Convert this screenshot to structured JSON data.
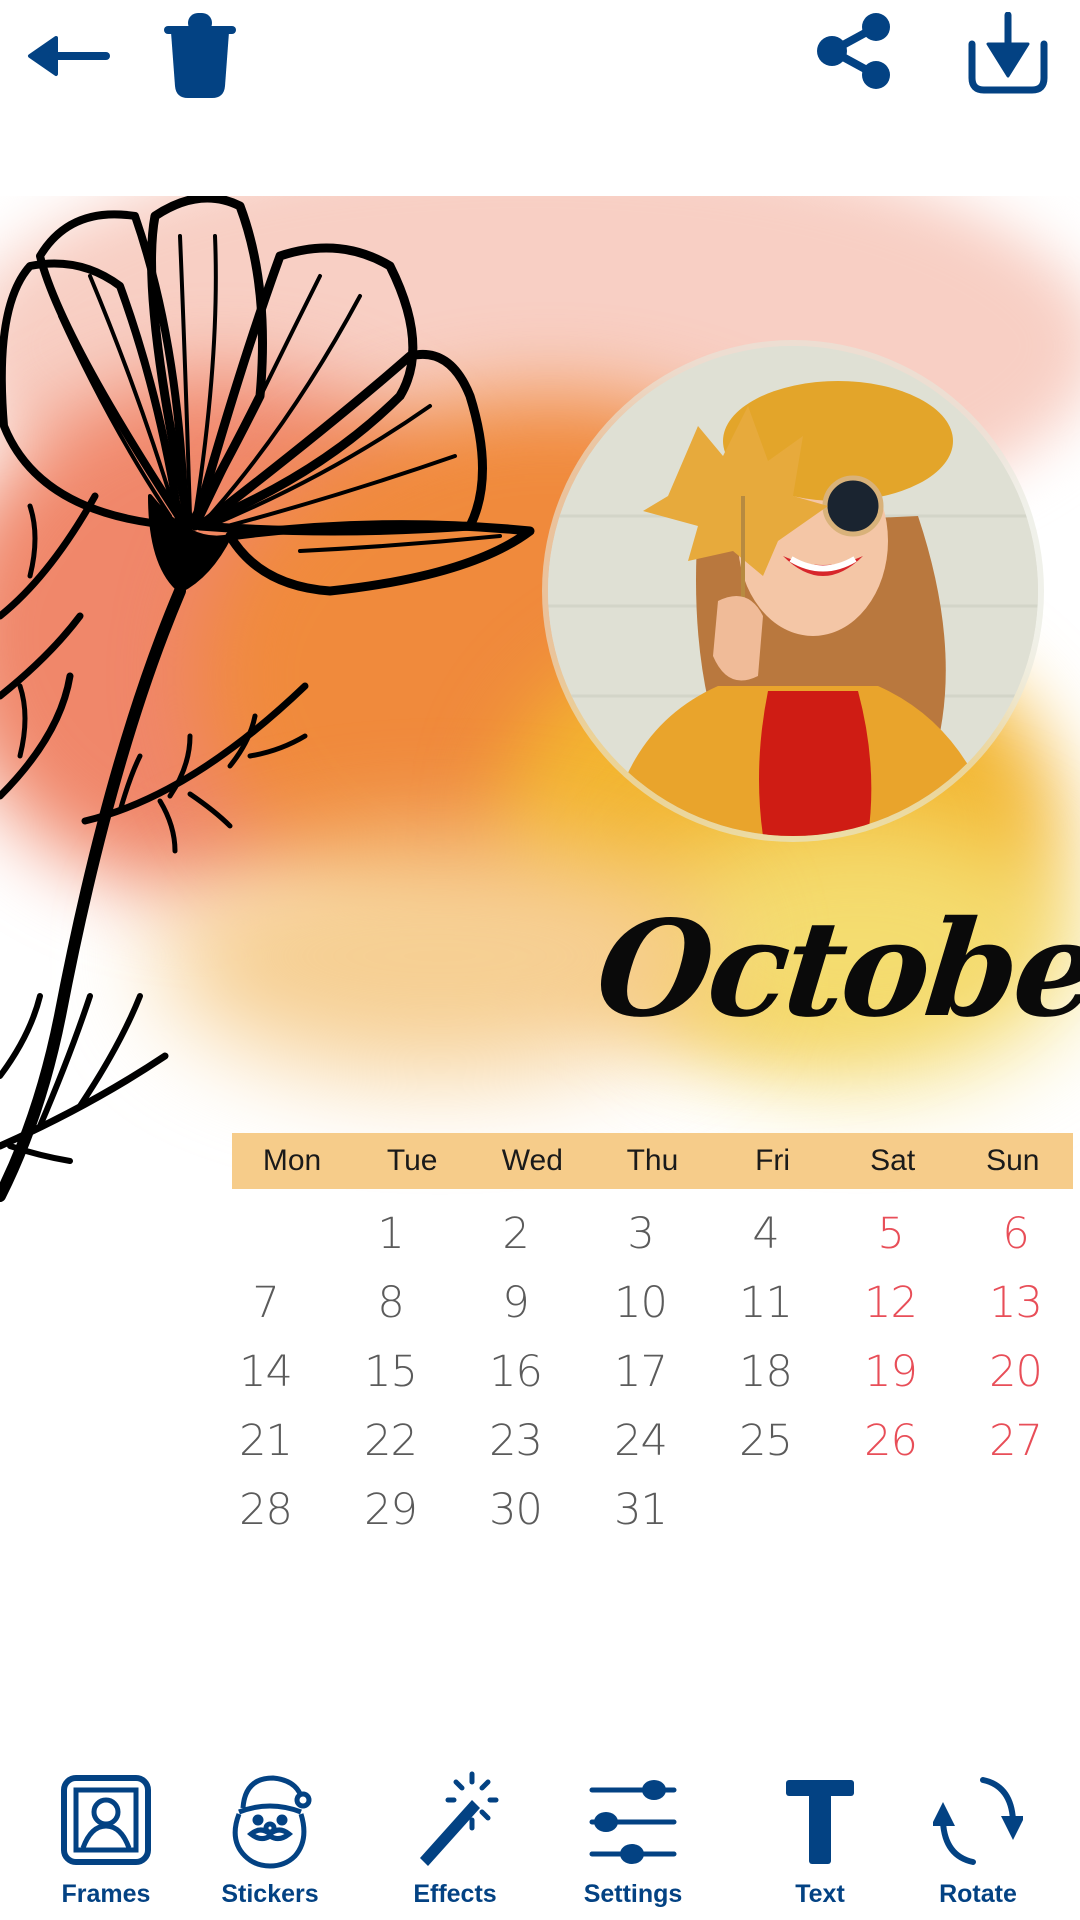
{
  "theme": {
    "accent": "#034283",
    "weekday_bar": "#f6cc8a",
    "weekend_red": "#e84e58",
    "date_gray": "#5b5b5b"
  },
  "topbar": {
    "back_icon": "arrow-left-icon",
    "delete_icon": "trash-icon",
    "share_icon": "share-icon",
    "download_icon": "download-icon"
  },
  "calendar": {
    "month": "October",
    "weekdays": [
      "Mon",
      "Tue",
      "Wed",
      "Thu",
      "Fri",
      "Sat",
      "Sun"
    ],
    "weeks": [
      [
        "",
        "1",
        "2",
        "3",
        "4",
        "5",
        "6"
      ],
      [
        "7",
        "8",
        "9",
        "10",
        "11",
        "12",
        "13"
      ],
      [
        "14",
        "15",
        "16",
        "17",
        "18",
        "19",
        "20"
      ],
      [
        "21",
        "22",
        "23",
        "24",
        "25",
        "26",
        "27"
      ],
      [
        "28",
        "29",
        "30",
        "31",
        "",
        "",
        ""
      ]
    ],
    "photo": "woman holding autumn maple leaf over eye, wearing beret and sunglasses"
  },
  "toolbar": {
    "items": [
      {
        "label": "Frames",
        "icon": "frame-portrait-icon"
      },
      {
        "label": "Stickers",
        "icon": "santa-icon"
      },
      {
        "label": "Effects",
        "icon": "magic-wand-icon"
      },
      {
        "label": "Settings",
        "icon": "sliders-icon"
      },
      {
        "label": "Text",
        "icon": "text-icon"
      },
      {
        "label": "Rotate",
        "icon": "rotate-icon"
      }
    ]
  }
}
